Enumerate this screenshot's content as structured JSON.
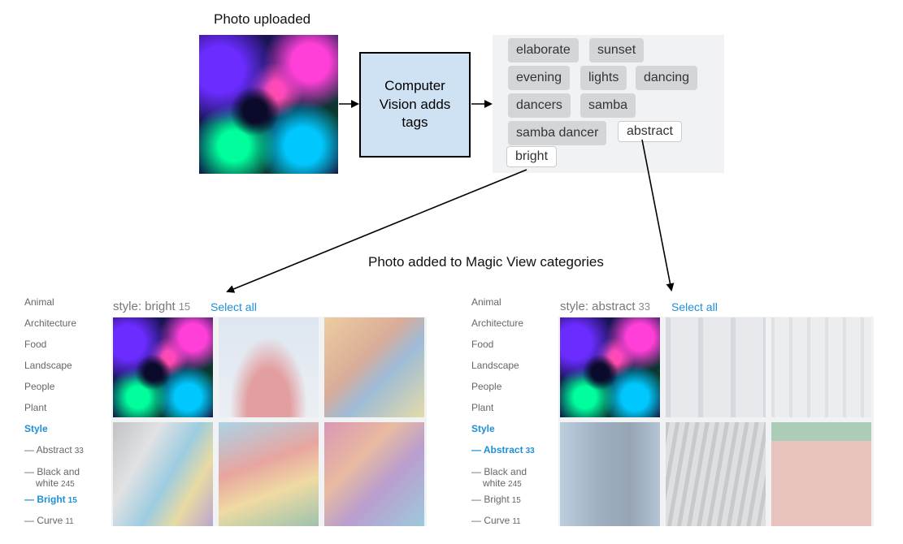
{
  "flow": {
    "upload_caption": "Photo uploaded",
    "process_label": "Computer Vision adds tags",
    "categories_caption": "Photo added to Magic View categories"
  },
  "tags": [
    "elaborate",
    "sunset",
    "evening",
    "lights",
    "dancing",
    "dancers",
    "samba",
    "samba dancer",
    "abstract",
    "bright"
  ],
  "sidebar": {
    "categories": [
      "Animal",
      "Architecture",
      "Food",
      "Landscape",
      "People",
      "Plant",
      "Style"
    ],
    "sub_abstract": "Abstract",
    "sub_abstract_count": "33",
    "sub_bw_line1": "Black and",
    "sub_bw_line2": "white",
    "sub_bw_count": "245",
    "sub_bright": "Bright",
    "sub_bright_count": "15",
    "sub_curve": "Curve",
    "sub_curve_count": "11",
    "dash": "—"
  },
  "left_panel": {
    "title": "style: bright",
    "count": "15",
    "select_all": "Select all"
  },
  "right_panel": {
    "title": "style: abstract",
    "count": "33",
    "select_all": "Select all"
  },
  "colors": {
    "link_blue": "#1e90d6",
    "process_fill": "#cfe2f3",
    "tag_gray": "#d3d6d8"
  }
}
